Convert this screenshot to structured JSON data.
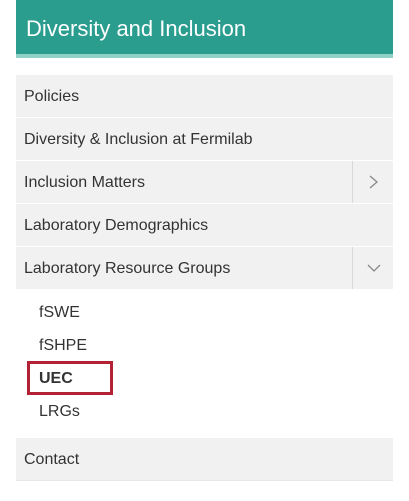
{
  "header": {
    "title": "Diversity and Inclusion"
  },
  "nav": {
    "items": [
      {
        "label": "Policies"
      },
      {
        "label": "Diversity & Inclusion at Fermilab"
      },
      {
        "label": "Inclusion Matters",
        "toggle": "chevron-right"
      },
      {
        "label": "Laboratory Demographics"
      },
      {
        "label": "Laboratory Resource Groups",
        "toggle": "chevron-down"
      }
    ],
    "subitems": [
      {
        "label": "fSWE"
      },
      {
        "label": "fSHPE"
      },
      {
        "label": "UEC",
        "active": true
      },
      {
        "label": "LRGs"
      }
    ],
    "contact": {
      "label": "Contact"
    }
  },
  "colors": {
    "header_bg": "#2a9d8f",
    "header_underline": "#8fd1c8",
    "item_bg": "#f1f1f1",
    "highlight": "#b22234"
  }
}
